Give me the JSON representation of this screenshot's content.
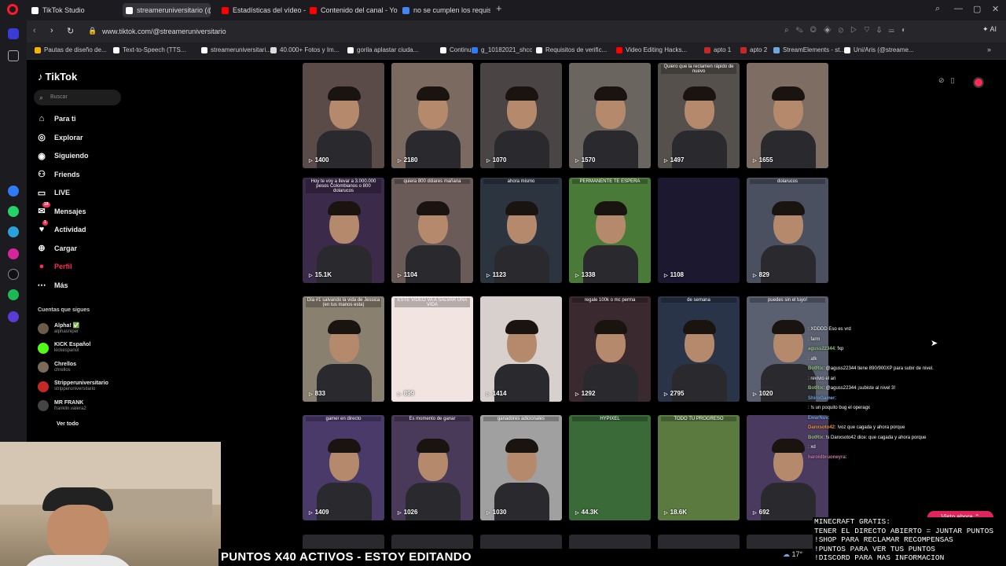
{
  "browser": {
    "tabs": [
      {
        "label": "TikTok Studio",
        "icon": "tiktok-icon",
        "color": "#ffffff"
      },
      {
        "label": "streameruniversitario (@s",
        "icon": "tiktok-icon",
        "color": "#ffffff",
        "active": true
      },
      {
        "label": "Estadísticas del vídeo - Yo",
        "icon": "youtube-icon",
        "color": "#ff0000"
      },
      {
        "label": "Contenido del canal - You",
        "icon": "youtube-icon",
        "color": "#ff0000"
      },
      {
        "label": "no se cumplen los requisit",
        "icon": "google-icon",
        "color": "#4285f4"
      }
    ],
    "new_tab": "+",
    "url": "www.tiktok.com/@streameruniversitario",
    "ai_label": "AI",
    "bookmarks": [
      "Pautas de diseño de...",
      "Text-to-Speech (TTS...",
      "streameruniversitari...",
      "40.000+ Fotos y Im...",
      "gorila aplastar ciuda...",
      "Continue",
      "g_10182021_shcc",
      "Requisitos de verific...",
      "Video Editing Hacks...",
      "apto 1",
      "apto 2",
      "StreamElements - st...",
      "Uni/Aris (@streame..."
    ]
  },
  "tiktok": {
    "logo": "TikTok",
    "search_placeholder": "Buscar",
    "nav": [
      {
        "label": "Para ti",
        "icon": "home-icon"
      },
      {
        "label": "Explorar",
        "icon": "compass-icon"
      },
      {
        "label": "Siguiendo",
        "icon": "following-icon"
      },
      {
        "label": "Friends",
        "icon": "friends-icon"
      },
      {
        "label": "LIVE",
        "icon": "live-icon"
      },
      {
        "label": "Mensajes",
        "icon": "message-icon",
        "badge": "18"
      },
      {
        "label": "Actividad",
        "icon": "activity-icon",
        "badge": "1"
      },
      {
        "label": "Cargar",
        "icon": "upload-icon"
      },
      {
        "label": "Perfil",
        "icon": "profile-icon",
        "accent": "#fe2c55"
      },
      {
        "label": "Más",
        "icon": "more-icon"
      }
    ],
    "following_title": "Cuentas que sigues",
    "following": [
      {
        "name": "Alpha! ✅",
        "handle": "alphasniper",
        "color": "#6b5b4b"
      },
      {
        "name": "KICK Español",
        "handle": "kickespanol",
        "color": "#53fc18"
      },
      {
        "name": "Chrellos",
        "handle": "chrellos",
        "color": "#7a6a5a"
      },
      {
        "name": "Stripperuniversitario",
        "handle": "stripperuniversitario",
        "color": "#c62828"
      },
      {
        "name": "MR FRANK",
        "handle": "franklin.valera2",
        "color": "#444444"
      }
    ],
    "see_all": "Ver todo"
  },
  "videos": [
    {
      "views": "1400",
      "caption": ""
    },
    {
      "views": "2180",
      "caption": ""
    },
    {
      "views": "1070",
      "caption": ""
    },
    {
      "views": "1570",
      "caption": ""
    },
    {
      "views": "1497",
      "caption": "Quiero que la reclamen rápido de nuevo"
    },
    {
      "views": "1655",
      "caption": ""
    },
    {
      "views": "15.1K",
      "caption": "Hoy te voy a llevar a 3.000.000 pesos Colombianos o 800 dolarucos"
    },
    {
      "views": "1104",
      "caption": "quiera 800 dólares mañana"
    },
    {
      "views": "1123",
      "caption": "ahora mismo"
    },
    {
      "views": "1338",
      "caption": "PERMANENTE TE ESPERA"
    },
    {
      "views": "1108",
      "caption": ""
    },
    {
      "views": "829",
      "caption": "dolarucos"
    },
    {
      "views": "833",
      "caption": "Día #1 salvando la vida de Jessica (en tus manos esta)"
    },
    {
      "views": "899",
      "caption": "ESTE VIDEO VA A SALVAR UNA VIDA"
    },
    {
      "views": "1414",
      "caption": ""
    },
    {
      "views": "1292",
      "caption": "regale 100k o mc perma"
    },
    {
      "views": "2795",
      "caption": "de semana"
    },
    {
      "views": "1020",
      "caption": "puedes sin el tuyo!"
    },
    {
      "views": "1409",
      "caption": "gamer en directo"
    },
    {
      "views": "1026",
      "caption": "Es momento de ganar"
    },
    {
      "views": "1030",
      "caption": "ganadores adicionales"
    },
    {
      "views": "44.3K",
      "caption": "HYPIXEL"
    },
    {
      "views": "18.6K",
      "caption": "TODO TU PROGRESO"
    },
    {
      "views": "692",
      "caption": ""
    }
  ],
  "chat": [
    {
      "user": "",
      "text": ": XDDDD Eso es vrd",
      "color": "#e06666"
    },
    {
      "user": "",
      "text": ": farm",
      "color": "#6fa8dc"
    },
    {
      "user": "aguss22344",
      "text": ": fxp",
      "color": "#93c47d"
    },
    {
      "user": "",
      "text": ": afk",
      "color": "#c27ba0"
    },
    {
      "user": "BotRix",
      "text": ": @aguss22344 tiene 890/900XP para subir de nivel.",
      "color": "#93c47d"
    },
    {
      "user": "",
      "text": ": revivio el ari",
      "color": "#e69138"
    },
    {
      "user": "BotRix",
      "text": ": @aguss22344 ¡subiste al nivel 3!",
      "color": "#93c47d"
    },
    {
      "user": "ShiroGamer",
      "text": ":",
      "color": "#6fa8dc"
    },
    {
      "user": "",
      "text": ": !s un poquito bug el operagx",
      "color": "#e06666"
    },
    {
      "user": "EwarNuv",
      "text": ":",
      "color": "#6fa8dc"
    },
    {
      "user": "Danxsoto42",
      "text": ": !voz que cagada y ahora porque",
      "color": "#e69138"
    },
    {
      "user": "BotRix",
      "text": ": !s Danxsoto42 dice: que cagada y ahora porque",
      "color": "#93c47d"
    },
    {
      "user": "",
      "text": ": xd",
      "color": "#e06666"
    },
    {
      "user": "haroldbruoneyra",
      "text": ":",
      "color": "#c27ba0"
    }
  ],
  "overlay": {
    "banner": "PUNTOS X40 ACTIVOS - ESTOY EDITANDO",
    "minecraft_lines": [
      "MINECRAFT GRATIS:",
      "TENER EL DIRECTO ABIERTO = JUNTAR PUNTOS",
      "!SHOP PARA RECLAMAR RECOMPENSAS",
      "!PUNTOS PARA VER TUS PUNTOS",
      "!DISCORD PARA MAS INFORMACION"
    ],
    "visto_button": "Visto ahora ⌃",
    "temperature": "17°"
  },
  "colors": {
    "accent": "#fe2c55",
    "opera": "#ff1b2d",
    "banner_bg": "#000000"
  }
}
